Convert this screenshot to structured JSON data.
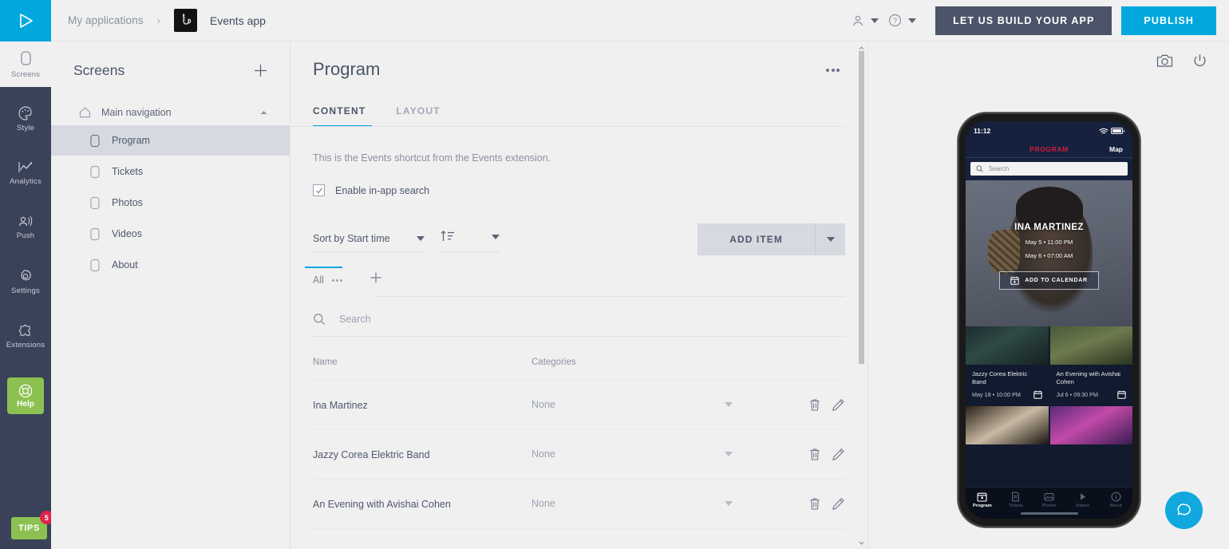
{
  "topbar": {
    "logo_icon": "play-triangle-logo",
    "breadcrumb_root": "My applications",
    "breadcrumb_sep": "›",
    "app_icon": "saxophone-app-icon",
    "app_name": "Events app",
    "account_icon": "user-icon",
    "help_icon": "question-circle-icon",
    "build_app_label": "LET US BUILD YOUR APP",
    "publish_label": "PUBLISH",
    "accent_cyan": "#00a8de",
    "dark_navy": "#4b5468"
  },
  "rail": {
    "items": [
      {
        "label": "Screens",
        "icon": "screens-icon",
        "active": true
      },
      {
        "label": "Style",
        "icon": "palette-icon",
        "active": false
      },
      {
        "label": "Analytics",
        "icon": "chart-icon",
        "active": false
      },
      {
        "label": "Push",
        "icon": "push-icon",
        "active": false
      },
      {
        "label": "Settings",
        "icon": "gear-icon",
        "active": false
      },
      {
        "label": "Extensions",
        "icon": "puzzle-icon",
        "active": false
      }
    ],
    "help_label": "Help",
    "help_icon": "lifebuoy-icon",
    "help_color": "#8cc152",
    "tips_label": "TIPS",
    "tips_badge": "5",
    "tips_badge_color": "#e0234e"
  },
  "screens": {
    "title": "Screens",
    "add_icon": "plus-icon",
    "group": {
      "label": "Main navigation",
      "icon": "home-icon",
      "collapse_icon": "chevron-up-icon"
    },
    "items": [
      {
        "label": "Program",
        "selected": true
      },
      {
        "label": "Tickets",
        "selected": false
      },
      {
        "label": "Photos",
        "selected": false
      },
      {
        "label": "Videos",
        "selected": false
      },
      {
        "label": "About",
        "selected": false
      }
    ]
  },
  "editor": {
    "title": "Program",
    "menu_icon": "more-horizontal-icon",
    "tabs": [
      {
        "label": "CONTENT",
        "active": true
      },
      {
        "label": "LAYOUT",
        "active": false
      }
    ],
    "description": "This is the Events shortcut from the Events extension.",
    "checkbox": {
      "label": "Enable in-app search",
      "checked": true
    },
    "sort_select": {
      "value": "Sort by Start time"
    },
    "order_select": {
      "icon": "sort-ascending-icon"
    },
    "add_item_label": "ADD ITEM",
    "add_item_caret_icon": "chevron-down-icon",
    "category_tabs": [
      {
        "label": "All",
        "active": true
      }
    ],
    "category_add_icon": "plus-icon",
    "search": {
      "placeholder": "Search",
      "value": "",
      "icon": "search-icon"
    },
    "table": {
      "columns": [
        "Name",
        "Categories"
      ],
      "rows": [
        {
          "name": "Ina Martinez",
          "category": "None"
        },
        {
          "name": "Jazzy Corea Elektric Band",
          "category": "None"
        },
        {
          "name": "An Evening with Avishai Cohen",
          "category": "None"
        }
      ],
      "row_actions": [
        "trash-icon",
        "pencil-icon"
      ]
    }
  },
  "preview": {
    "tools": [
      "camera-icon",
      "power-icon"
    ],
    "status": {
      "time": "11:12",
      "wifi_icon": "wifi-icon",
      "battery_icon": "battery-icon"
    },
    "nav": {
      "main": "PROGRAM",
      "alt": "Map",
      "main_color": "#d31c3c"
    },
    "search": {
      "placeholder": "Search",
      "icon": "search-icon"
    },
    "hero": {
      "name": "INA MARTINEZ",
      "date_start": "May 5 • 11:00 PM",
      "date_end": "May 6 • 07:00 AM",
      "calendar_label": "ADD TO CALENDAR",
      "calendar_icon": "calendar-plus-icon"
    },
    "cards": [
      {
        "title": "Jazzy Corea Elektric Band",
        "date": "May 18 • 10:00 PM",
        "icon": "calendar-icon"
      },
      {
        "title": "An Evening with Avishai Cohen",
        "date": "Jul 6 • 09:30 PM",
        "icon": "calendar-icon"
      }
    ],
    "tabbar": [
      {
        "label": "Program",
        "icon": "calendar-icon",
        "active": true
      },
      {
        "label": "Tickets",
        "icon": "ticket-icon",
        "active": false
      },
      {
        "label": "Photos",
        "icon": "photo-icon",
        "active": false
      },
      {
        "label": "Videos",
        "icon": "play-icon",
        "active": false
      },
      {
        "label": "About",
        "icon": "info-icon",
        "active": false
      }
    ]
  },
  "chat_widget": {
    "icon": "chat-bubble-icon",
    "color": "#11a7df"
  }
}
